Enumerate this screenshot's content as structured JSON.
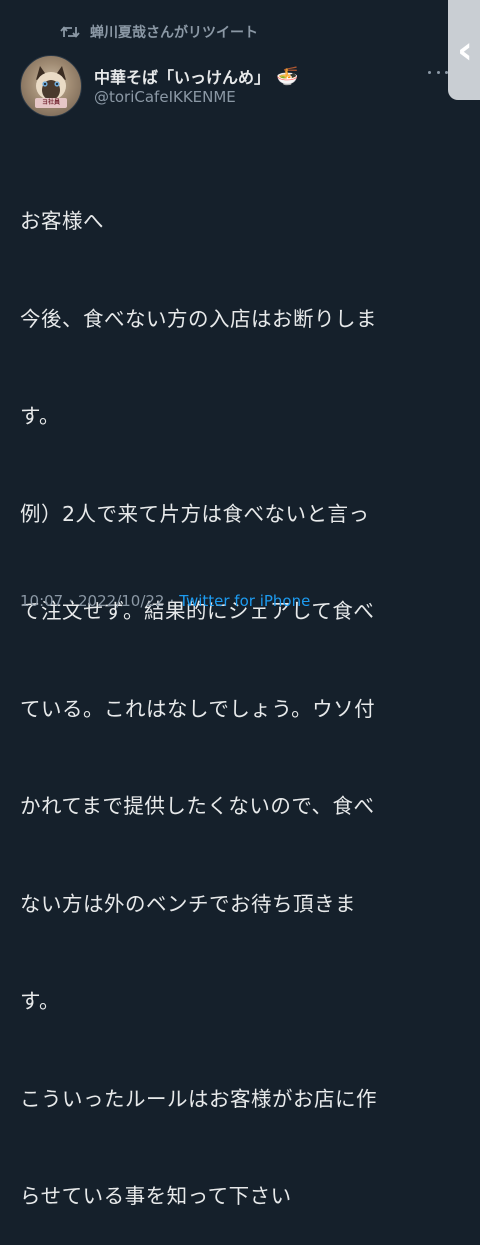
{
  "retweet": {
    "icon": "retweet-icon",
    "text": "蝉川夏哉さんがリツイート"
  },
  "author": {
    "display_name": "中華そば「いっけんめ」",
    "emoji": "🍜",
    "handle": "@toriCafeIKKENME",
    "avatar_sign": "ヨ社員"
  },
  "side_tab": {
    "chevron": "‹"
  },
  "tweet": {
    "lines": [
      "お客様へ",
      "今後、食べない方の入店はお断りしま",
      "す。",
      "例）2人で来て片方は食べないと言っ",
      "て注文せず。結果的にシェアして食べ",
      "ている。これはなしでしょう。ウソ付",
      "かれてまで提供したくないので、食べ",
      "ない方は外のベンチでお待ち頂きま",
      "す。",
      "こういったルールはお客様がお店に作",
      "らせている事を知って下さい"
    ]
  },
  "meta": {
    "time": "10:07",
    "separator": "·",
    "date": "2022/10/22",
    "separator2": "·",
    "source": "Twitter for iPhone"
  },
  "colors": {
    "background": "#15202b",
    "text": "#e7e9ea",
    "muted": "#8b98a5",
    "link": "#1d9bf0"
  }
}
